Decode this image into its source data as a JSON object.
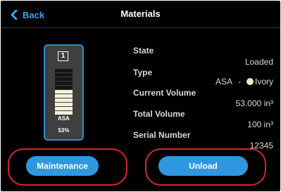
{
  "header": {
    "back_label": "Back",
    "title": "Materials"
  },
  "material_card": {
    "bay_number": "1",
    "type": "ASA",
    "percent": "53%",
    "fill_level": 0.53,
    "fill_color": "#f4f1dc",
    "border_color": "#2a8ed0"
  },
  "details": {
    "state_label": "State",
    "state_value": "Loaded",
    "type_label": "Type",
    "type_value": "ASA",
    "type_separator": "-",
    "color_name": "Ivory",
    "color_swatch": "#ece6cc",
    "current_volume_label": "Current Volume",
    "current_volume_value": "53.000 in³",
    "total_volume_label": "Total Volume",
    "total_volume_value": "100 in³",
    "serial_number_label": "Serial Number",
    "serial_number_value": "12345"
  },
  "buttons": {
    "maintenance_label": "Maintenance",
    "unload_label": "Unload",
    "accent_color": "#2f97e0",
    "highlight_color": "#d7232b"
  }
}
